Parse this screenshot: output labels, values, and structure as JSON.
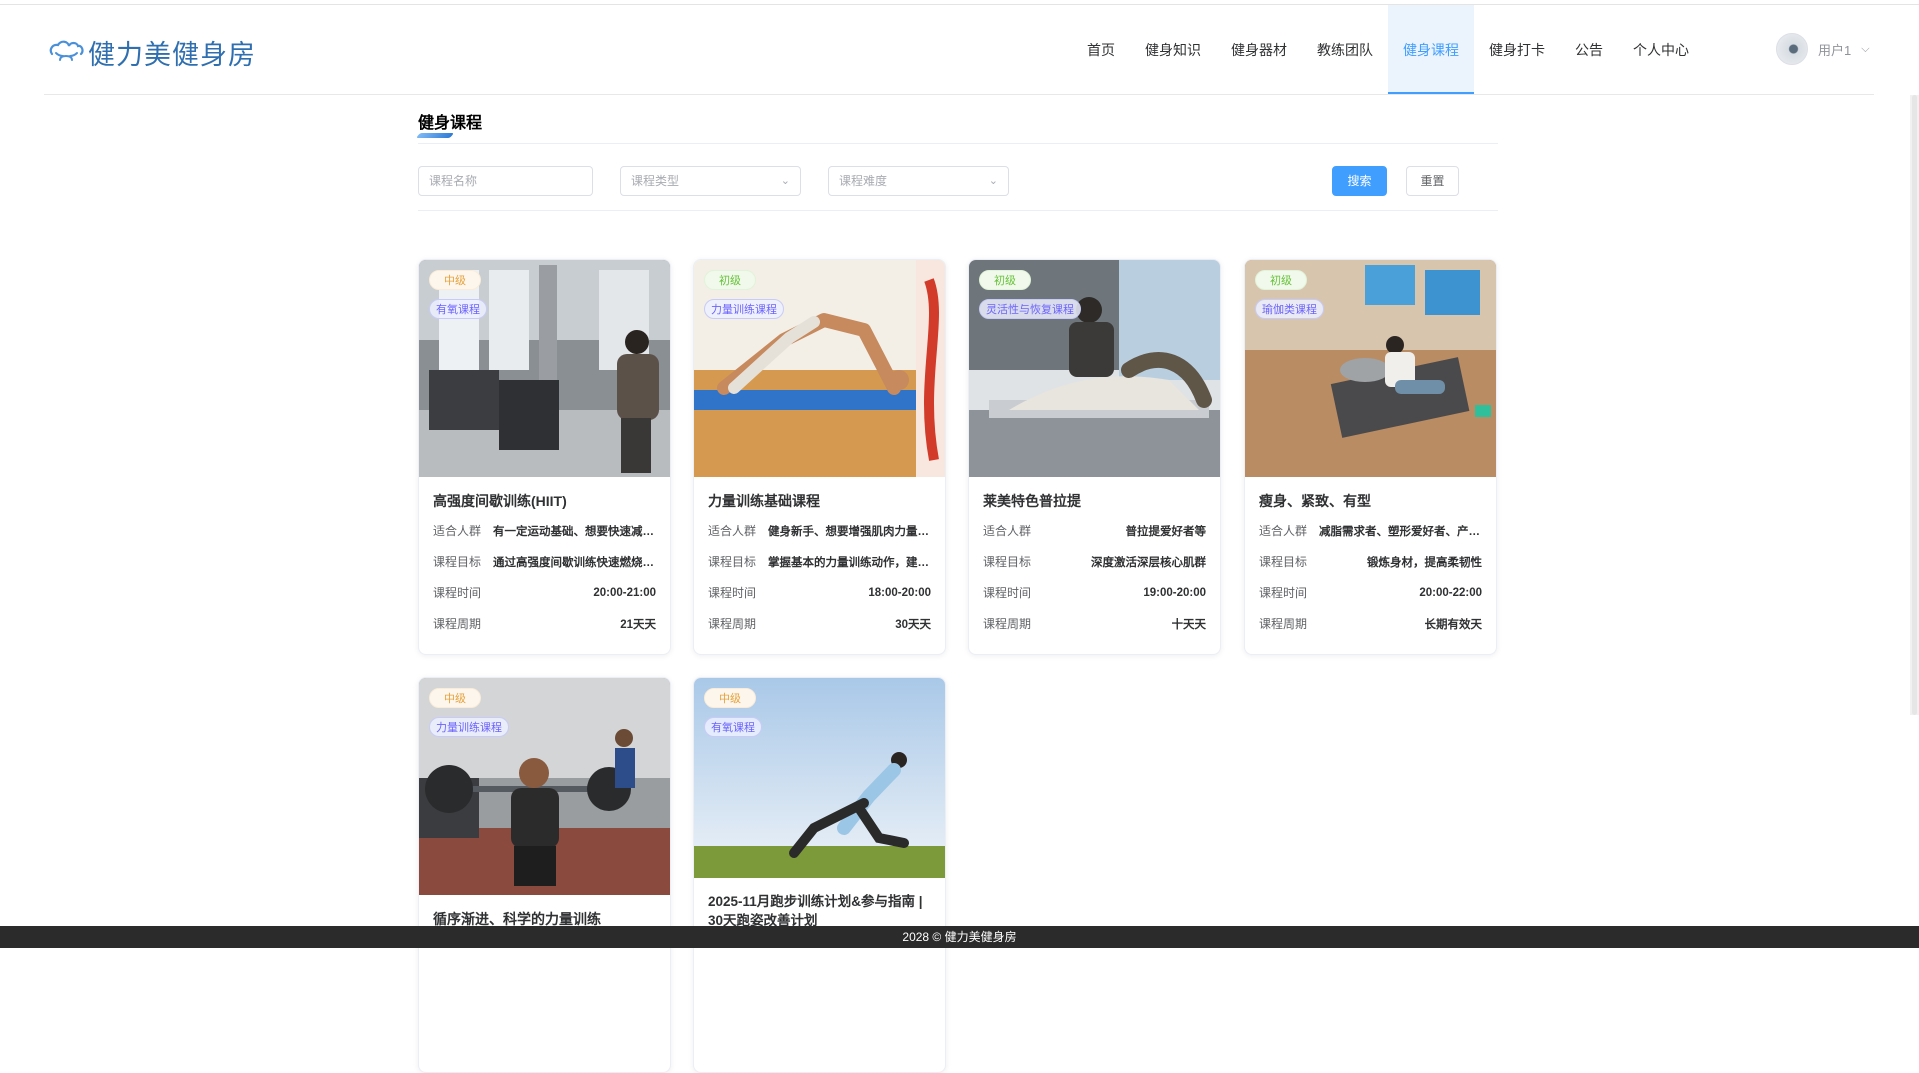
{
  "brand": {
    "name": "健力美健身房"
  },
  "nav": {
    "items": [
      "首页",
      "健身知识",
      "健身器材",
      "教练团队",
      "健身课程",
      "健身打卡",
      "公告",
      "个人中心"
    ],
    "active_index": 4
  },
  "user": {
    "name": "用户1"
  },
  "page_title": "健身课程",
  "filters": {
    "name_placeholder": "课程名称",
    "type_placeholder": "课程类型",
    "difficulty_placeholder": "课程难度",
    "search_label": "搜索",
    "reset_label": "重置"
  },
  "field_labels": {
    "audience": "适合人群",
    "goal": "课程目标",
    "time": "课程时间",
    "period": "课程周期"
  },
  "courses": [
    {
      "level": "中级",
      "type": "有氧课程",
      "name": "高强度间歇训练(HIIT)",
      "audience": "有一定运动基础、想要快速减脂的人群",
      "goal": "通过高强度间歇训练快速燃烧脂肪",
      "time": "20:00-21:00",
      "period": "21天天"
    },
    {
      "level": "初级",
      "type": "力量训练课程",
      "name": "力量训练基础课程",
      "audience": "健身新手、想要增强肌肉力量的人群",
      "goal": "掌握基本的力量训练动作，建立正确姿势",
      "time": "18:00-20:00",
      "period": "30天天"
    },
    {
      "level": "初级",
      "type": "灵活性与恢复课程",
      "name": "莱美特色普拉提",
      "audience": "普拉提爱好者等",
      "goal": "深度激活深层核心肌群",
      "time": "19:00-20:00",
      "period": "十天天"
    },
    {
      "level": "初级",
      "type": "瑜伽类课程",
      "name": "瘦身、紧致、有型",
      "audience": "减脂需求者、塑形爱好者、产后恢复者",
      "goal": "锻炼身材，提高柔韧性",
      "time": "20:00-22:00",
      "period": "长期有效天"
    },
    {
      "level": "中级",
      "type": "力量训练课程",
      "name": "循序渐进、科学的力量训练"
    },
    {
      "level": "中级",
      "type": "有氧课程",
      "name": "2025-11月跑步训练计划&参与指南 | 30天跑姿改善计划"
    }
  ],
  "footer": {
    "text": "2028 © 健力美健身房"
  },
  "colors": {
    "accent": "#409eff",
    "footer_bg": "#2b2b2b"
  }
}
